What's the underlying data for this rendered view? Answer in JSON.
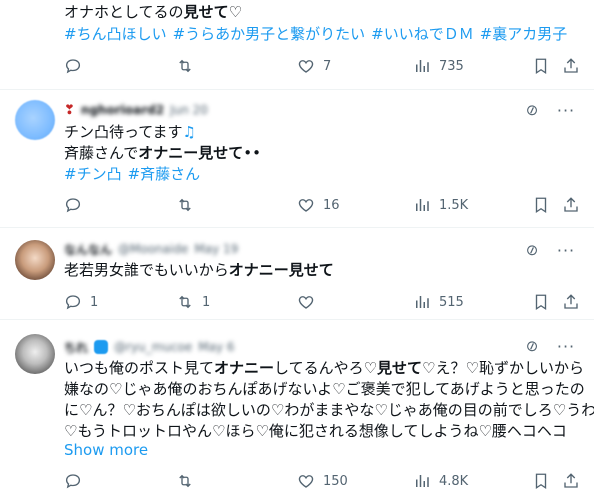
{
  "posts": [
    {
      "text_lines": [
        {
          "before": "オナホとしてるの",
          "bold": "見せて",
          "after": "♡"
        }
      ],
      "hashtags": [
        "#ちん凸ほしい",
        "#うらあか男子と繋がりたい",
        "#いいねでＤＭ",
        "#裏アカ男子"
      ],
      "stats": {
        "replies": "",
        "reposts": "",
        "likes": "7",
        "views": "735"
      }
    },
    {
      "header": {
        "emoji": "❣",
        "name": "nghorioard2",
        "time": "Jun 20"
      },
      "line1": "チン凸待ってます",
      "line1_icon": "♫",
      "line2_before": "斉藤さんで",
      "line2_bold": "オナニー見せて",
      "line2_after": "••",
      "hashtags": [
        "#チン凸",
        "#斉藤さん"
      ],
      "stats": {
        "replies": "",
        "reposts": "",
        "likes": "16",
        "views": "1.5K"
      }
    },
    {
      "header": {
        "name": "なんなん",
        "handle": "@Moonaide",
        "time": "May 19"
      },
      "text_before": "老若男女誰でもいいから",
      "text_bold": "オナニー見せて",
      "stats": {
        "replies": "1",
        "reposts": "1",
        "likes": "",
        "views": "515"
      }
    },
    {
      "header": {
        "name": "ちれ",
        "handle": "@ryu_mucoe",
        "time": "May 6"
      },
      "l1a": "いつも俺のポスト見て",
      "l1b": "オナニー",
      "l1c": "してるんやろ♡",
      "l1d": "見せて",
      "l1e": "♡え？♡恥ずかしいから",
      "l2": "嫌なの♡じゃあ俺のおちんぽあげないよ♡ご褒美で犯してあげようと思ったの",
      "l3": "に♡ん？♡おちんぽは欲しいの♡わがままやな♡じゃあ俺の目の前でしろ♡うわ",
      "l4": "♡もうトロットロやん♡ほら♡俺に犯される想像してしようね♡腰ヘコヘコ",
      "show_more": "Show more",
      "stats": {
        "replies": "",
        "reposts": "",
        "likes": "150",
        "views": "4.8K"
      }
    }
  ],
  "colors": {
    "link": "#1d9bf0",
    "text": "#0f1419",
    "muted": "#536471",
    "divider": "#eff3f4"
  }
}
